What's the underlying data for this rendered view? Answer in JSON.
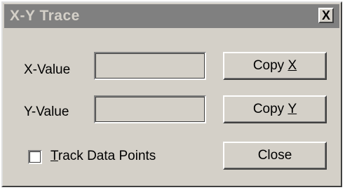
{
  "window": {
    "title": "X-Y Trace",
    "close_glyph": "X"
  },
  "fields": {
    "x_label": "X-Value",
    "x_value": "",
    "y_label": "Y-Value",
    "y_value": ""
  },
  "buttons": {
    "copy_x_prefix": "Copy ",
    "copy_x_key": "X",
    "copy_y_prefix": "Copy ",
    "copy_y_key": "Y",
    "close": "Close"
  },
  "checkbox": {
    "label_key": "T",
    "label_rest": "rack Data Points",
    "checked": false
  }
}
